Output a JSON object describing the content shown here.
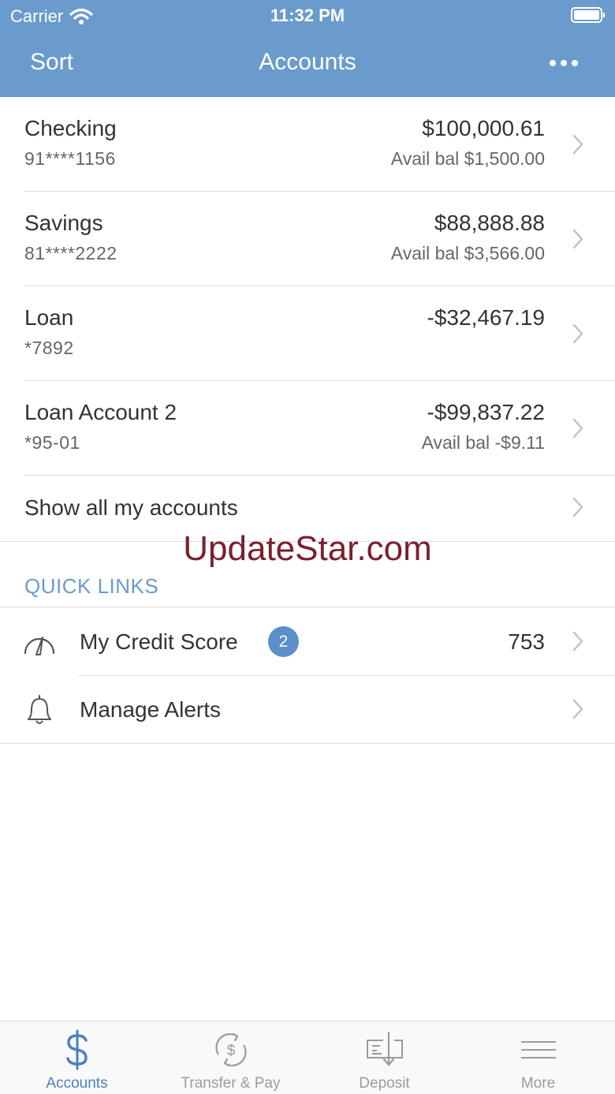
{
  "status_bar": {
    "carrier": "Carrier",
    "time": "11:32 PM"
  },
  "nav": {
    "sort_label": "Sort",
    "title": "Accounts"
  },
  "accounts": [
    {
      "name": "Checking",
      "number": "91****1156",
      "balance": "$100,000.61",
      "avail": "Avail bal $1,500.00"
    },
    {
      "name": "Savings",
      "number": "81****2222",
      "balance": "$88,888.88",
      "avail": "Avail bal $3,566.00"
    },
    {
      "name": "Loan",
      "number": "*7892",
      "balance": "-$32,467.19",
      "avail": ""
    },
    {
      "name": "Loan Account 2",
      "number": "*95-01",
      "balance": "-$99,837.22",
      "avail": "Avail bal -$9.11"
    }
  ],
  "show_all_label": "Show all my accounts",
  "watermark": "UpdateStar.com",
  "quick_links": {
    "heading": "QUICK LINKS",
    "items": [
      {
        "label": "My Credit Score",
        "badge": "2",
        "value": "753",
        "icon": "gauge-icon"
      },
      {
        "label": "Manage Alerts",
        "icon": "bell-icon"
      }
    ]
  },
  "tabs": [
    {
      "label": "Accounts",
      "icon": "dollar-icon",
      "active": true
    },
    {
      "label": "Transfer & Pay",
      "icon": "transfer-icon",
      "active": false
    },
    {
      "label": "Deposit",
      "icon": "check-deposit-icon",
      "active": false
    },
    {
      "label": "More",
      "icon": "hamburger-menu-icon",
      "active": false
    }
  ],
  "colors": {
    "header": "#6b9bcc",
    "accent": "#4a82c0",
    "badge": "#5b8fc9",
    "watermark": "#7a1f2b",
    "tab_inactive": "#9b9b9b"
  }
}
